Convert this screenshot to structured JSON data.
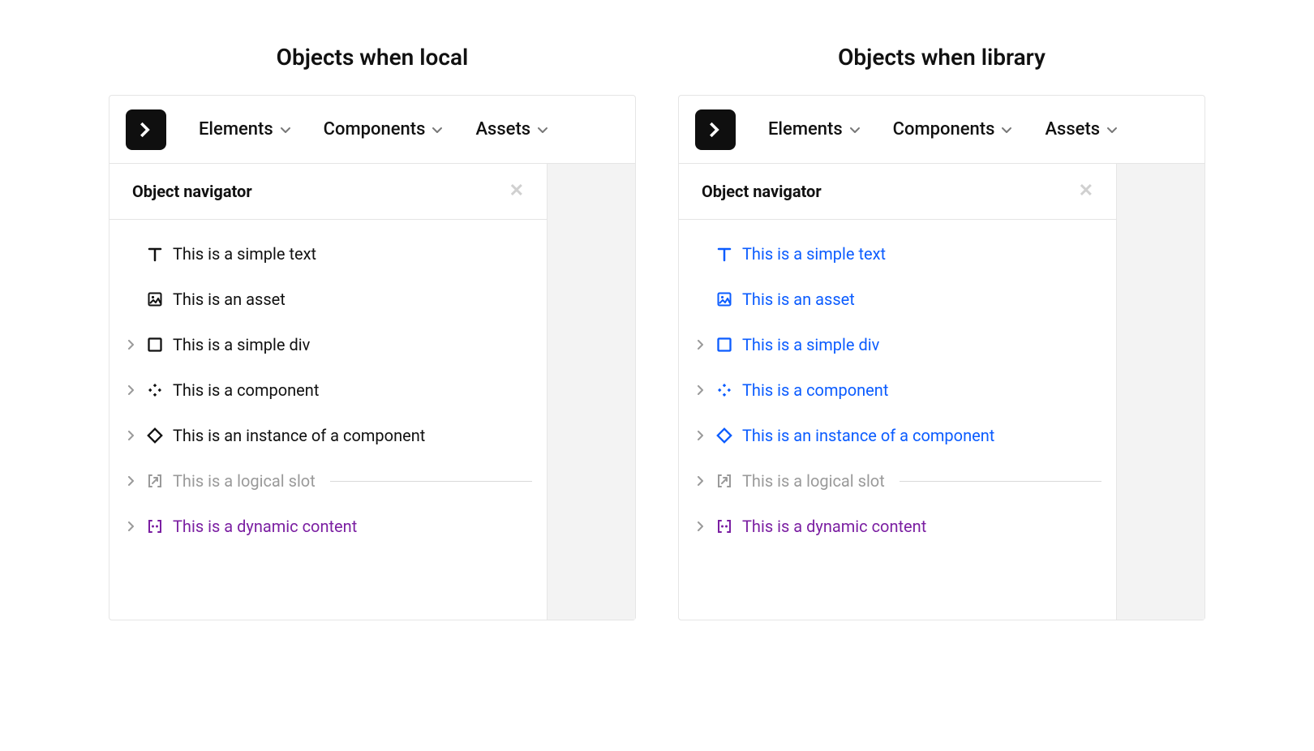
{
  "left": {
    "title": "Objects when local",
    "toolbar": {
      "tabs": [
        "Elements",
        "Components",
        "Assets"
      ]
    },
    "navigator": {
      "title": "Object navigator",
      "rows": [
        {
          "kind": "text",
          "label": "This is a simple text",
          "expandable": false,
          "colorClass": ""
        },
        {
          "kind": "asset",
          "label": "This is an asset",
          "expandable": false,
          "colorClass": ""
        },
        {
          "kind": "div",
          "label": "This is a simple div",
          "expandable": true,
          "colorClass": ""
        },
        {
          "kind": "component",
          "label": "This is a component",
          "expandable": true,
          "colorClass": ""
        },
        {
          "kind": "instance",
          "label": "This is an instance of a component",
          "expandable": true,
          "colorClass": ""
        },
        {
          "kind": "slot",
          "label": "This is a logical slot",
          "expandable": true,
          "colorClass": "gray",
          "trailing": true
        },
        {
          "kind": "dynamic",
          "label": "This is a dynamic content",
          "expandable": true,
          "colorClass": "purple"
        }
      ]
    }
  },
  "right": {
    "title": "Objects when library",
    "toolbar": {
      "tabs": [
        "Elements",
        "Components",
        "Assets"
      ]
    },
    "navigator": {
      "title": "Object navigator",
      "rows": [
        {
          "kind": "text",
          "label": "This is a simple text",
          "expandable": false,
          "colorClass": "blue"
        },
        {
          "kind": "asset",
          "label": "This is an asset",
          "expandable": false,
          "colorClass": "blue"
        },
        {
          "kind": "div",
          "label": "This is a simple div",
          "expandable": true,
          "colorClass": "blue"
        },
        {
          "kind": "component",
          "label": "This is a component",
          "expandable": true,
          "colorClass": "blue"
        },
        {
          "kind": "instance",
          "label": "This is an instance of a component",
          "expandable": true,
          "colorClass": "blue"
        },
        {
          "kind": "slot",
          "label": "This is a logical slot",
          "expandable": true,
          "colorClass": "gray",
          "trailing": true
        },
        {
          "kind": "dynamic",
          "label": "This is a dynamic content",
          "expandable": true,
          "colorClass": "purple"
        }
      ]
    }
  }
}
